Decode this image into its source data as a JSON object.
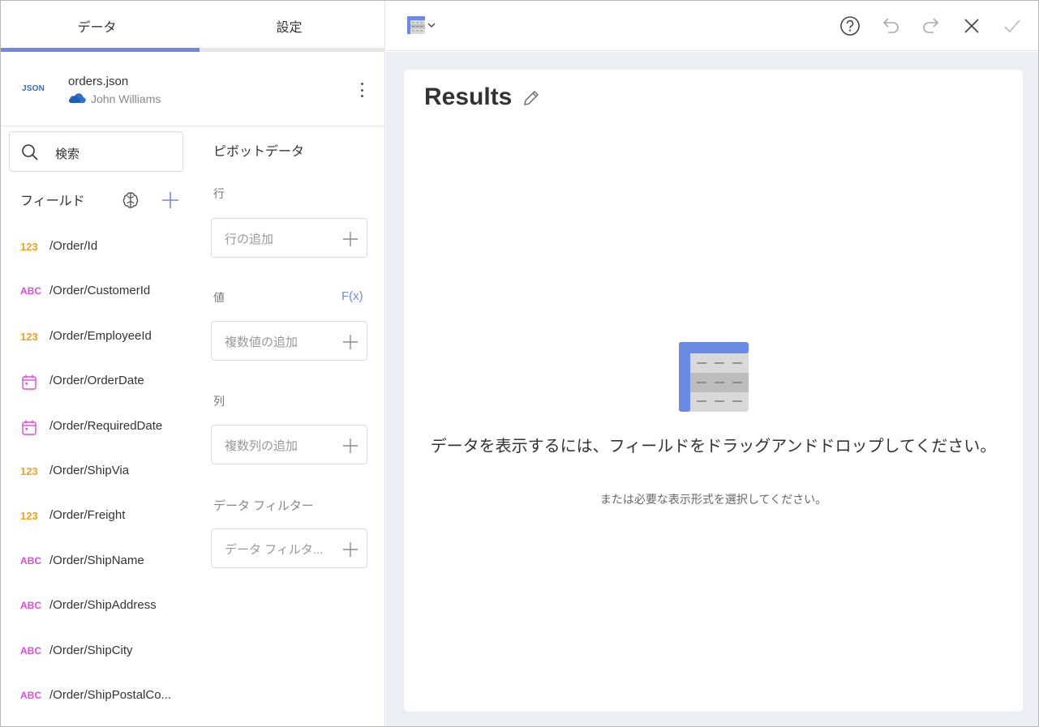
{
  "tabs": [
    {
      "label": "データ"
    },
    {
      "label": "設定"
    }
  ],
  "source": {
    "badge": "JSON",
    "name": "orders.json",
    "owner": "John Williams"
  },
  "search": {
    "text": "検索"
  },
  "fields": {
    "heading": "フィールド",
    "items": [
      {
        "type": "123",
        "kind": "num",
        "name": "/Order/Id"
      },
      {
        "type": "ABC",
        "kind": "str",
        "name": "/Order/CustomerId"
      },
      {
        "type": "123",
        "kind": "num",
        "name": "/Order/EmployeeId"
      },
      {
        "type": "",
        "kind": "date",
        "name": "/Order/OrderDate"
      },
      {
        "type": "",
        "kind": "date",
        "name": "/Order/RequiredDate"
      },
      {
        "type": "123",
        "kind": "num",
        "name": "/Order/ShipVia"
      },
      {
        "type": "123",
        "kind": "num",
        "name": "/Order/Freight"
      },
      {
        "type": "ABC",
        "kind": "str",
        "name": "/Order/ShipName"
      },
      {
        "type": "ABC",
        "kind": "str",
        "name": "/Order/ShipAddress"
      },
      {
        "type": "ABC",
        "kind": "str",
        "name": "/Order/ShipCity"
      },
      {
        "type": "ABC",
        "kind": "str",
        "name": "/Order/ShipPostalCo..."
      }
    ]
  },
  "pivot": {
    "title": "ピボットデータ",
    "rows_label": "行",
    "rows_placeholder": "行の追加",
    "values_label": "値",
    "fx_label": "F(x)",
    "values_placeholder": "複数値の追加",
    "columns_label": "列",
    "columns_placeholder": "複数列の追加",
    "filter_label": "データ フィルター",
    "filter_placeholder": "データ フィルタ..."
  },
  "card": {
    "title": "Results",
    "empty_main": "データを表示するには、フィールドをドラッグアンドドロップしてください。",
    "empty_sub": "または必要な表示形式を選択してください。"
  },
  "colors": {
    "accent": "#6b8ae6",
    "number": "#f0a026",
    "string": "#d84ed9",
    "cloud": "#2d6fc9"
  }
}
